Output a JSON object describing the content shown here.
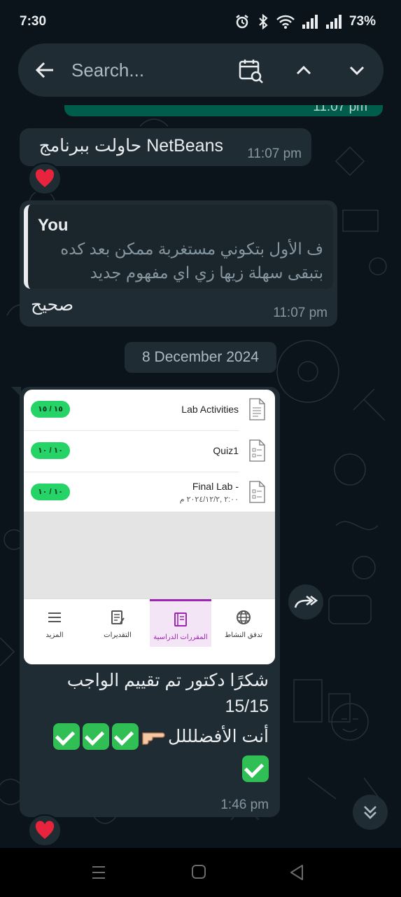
{
  "status_bar": {
    "time": "7:30",
    "battery": "73%"
  },
  "search": {
    "placeholder": "Search..."
  },
  "messages": {
    "partial_out_time": "11:07 pm",
    "m1": {
      "text": "حاولت ببرنامج NetBeans",
      "time": "11:07 pm"
    },
    "m2": {
      "quote_author": "You",
      "quote_line1": "ف الأول بتكوني مستغربة ممكن بعد كده",
      "quote_line2": "بتبقى سهلة زيها زي اي مفهوم جديد",
      "text": "صحيح",
      "time": "11:07 pm"
    },
    "date_chip": "8 December 2024",
    "m3": {
      "screenshot": {
        "rows": [
          {
            "label": "Lab Activities",
            "sub": "",
            "badge": "١٥ / ١٥"
          },
          {
            "label": "Quiz1",
            "sub": "",
            "badge": "١٠ / ١٠"
          },
          {
            "label": "Final Lab -",
            "sub": "٢:٠٠ ,٢٠٢٤/١٢/٢ م",
            "badge": "١٠ / ١٠"
          }
        ],
        "tabs": [
          {
            "label": "المزيد",
            "icon": "menu-icon"
          },
          {
            "label": "التقديرات",
            "icon": "grades-icon"
          },
          {
            "label": "المقررات الدراسية",
            "icon": "courses-icon"
          },
          {
            "label": "تدفق النشاط",
            "icon": "globe-icon"
          }
        ]
      },
      "caption_line1": "شكرًا دكتور تم تقييم الواجب",
      "caption_line2": "15/15",
      "caption_line3": "أنت الأفضلللل",
      "time": "1:46 pm"
    }
  },
  "reactions": {
    "emoji": "heart"
  },
  "colors": {
    "bubble_in": "#1f2c34",
    "bubble_out": "#005c4b",
    "badge_green": "#25d366",
    "tab_active": "#9c27b0"
  }
}
